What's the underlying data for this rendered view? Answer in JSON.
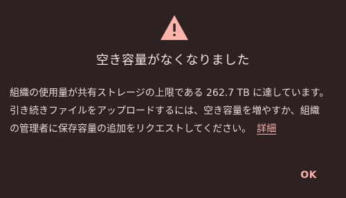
{
  "dialog": {
    "title": "空き容量がなくなりました",
    "icon": "warning-icon",
    "accent_color": "#ffb4ab",
    "message_lines": [
      "組織の使用量が共有ストレージの上限である 262.7 TB に達しています。",
      "引き続きファイルをアップロードするには、空き容量を増やすか、組織",
      "の管理者に保存容量の追加をリクエストしてください。"
    ],
    "learn_more_label": "詳細",
    "ok_label": "OK"
  }
}
